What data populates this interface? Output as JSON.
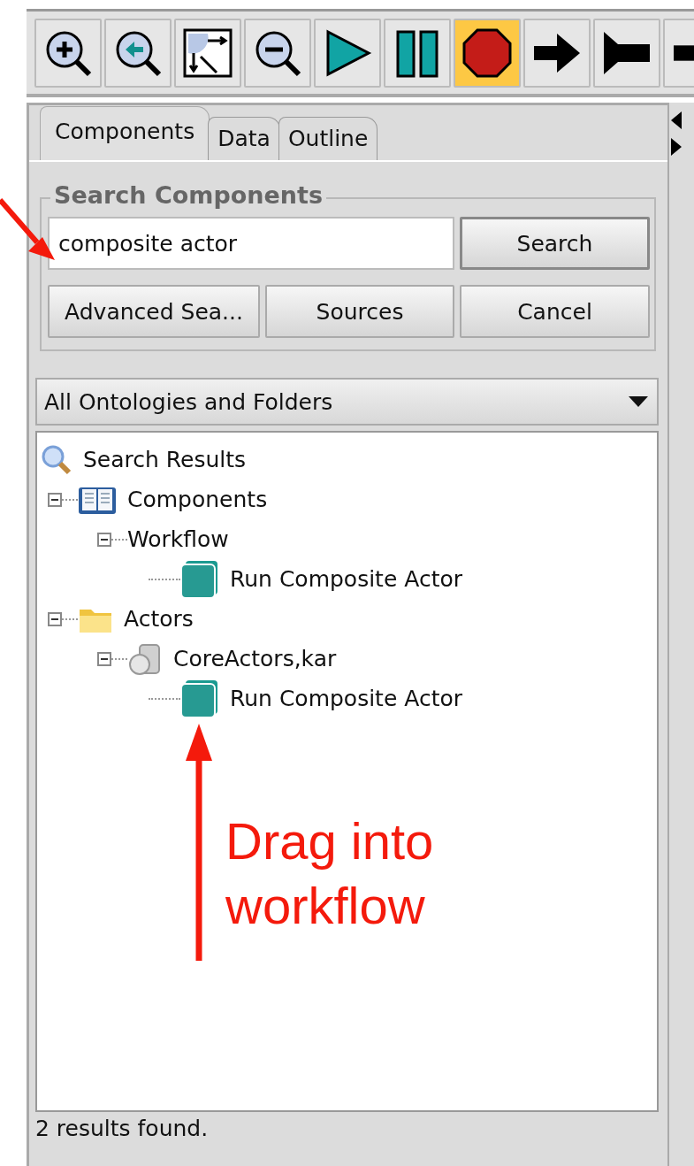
{
  "toolbar": {
    "buttons": [
      {
        "kind": "zoom-in",
        "selected": false
      },
      {
        "kind": "zoom-reset",
        "selected": false
      },
      {
        "kind": "zoom-fit",
        "selected": false
      },
      {
        "kind": "zoom-out",
        "selected": false
      },
      {
        "kind": "run",
        "selected": false
      },
      {
        "kind": "pause",
        "selected": false
      },
      {
        "kind": "stop",
        "selected": true
      },
      {
        "kind": "arrow",
        "selected": false
      },
      {
        "kind": "flag",
        "selected": false
      },
      {
        "kind": "cut",
        "selected": false
      }
    ]
  },
  "tabs": [
    {
      "label": "Components",
      "selected": true
    },
    {
      "label": "Data",
      "selected": false
    },
    {
      "label": "Outline",
      "selected": false
    }
  ],
  "search": {
    "title": "Search Components",
    "value": "composite actor",
    "buttons": [
      "Search",
      "Advanced Sea...",
      "Sources",
      "Cancel"
    ]
  },
  "dropdown": {
    "value": "All Ontologies and Folders"
  },
  "tree": [
    {
      "label": "Search Results",
      "kind": "search",
      "children": [
        {
          "label": "Components",
          "kind": "book",
          "expanded": true,
          "children": [
            {
              "label": "Workflow",
              "kind": "plain",
              "expanded": true,
              "children": [
                {
                  "label": "Run Composite Actor",
                  "kind": "actor"
                }
              ]
            }
          ]
        },
        {
          "label": "Actors",
          "kind": "folder",
          "expanded": true,
          "children": [
            {
              "label": "CoreActors,kar",
              "kind": "jar",
              "expanded": true,
              "children": [
                {
                  "label": "Run Composite Actor",
                  "kind": "actor"
                }
              ]
            }
          ]
        }
      ]
    }
  ],
  "status": "2 results found.",
  "annotation": {
    "text": "Drag into workflow"
  }
}
